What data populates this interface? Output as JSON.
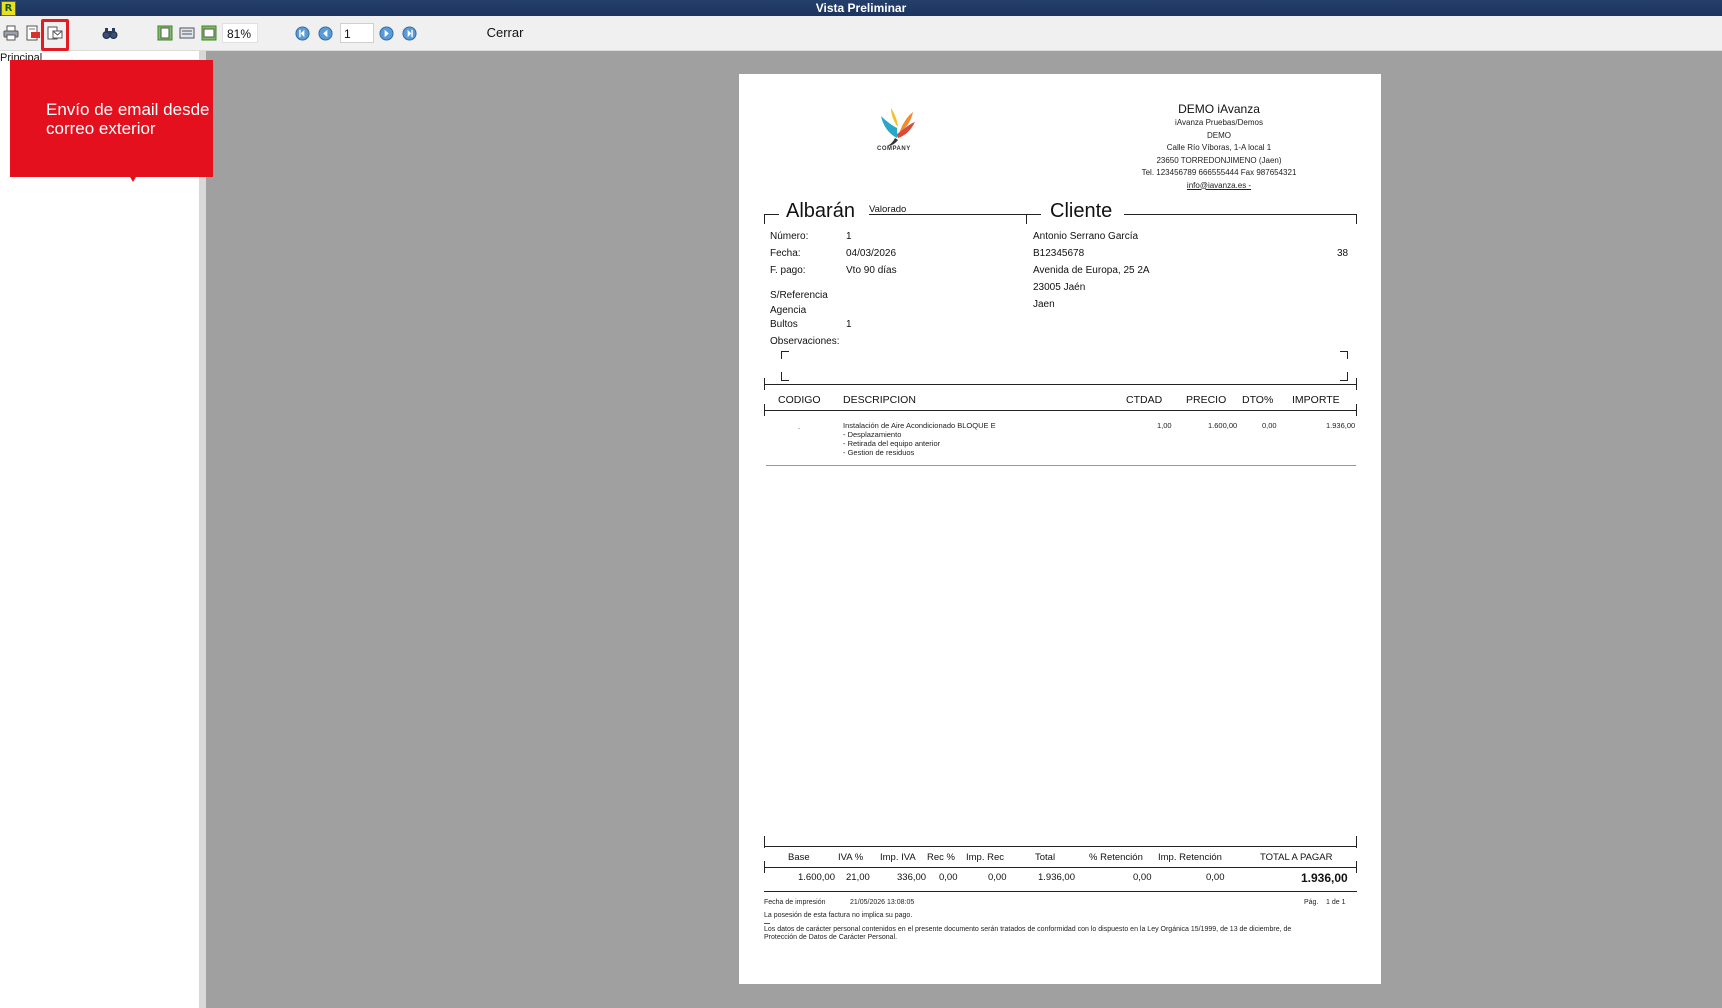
{
  "window": {
    "title": "Vista Preliminar",
    "app_icon_letter": "R"
  },
  "toolbar": {
    "zoom": "81%",
    "page_value": "1",
    "close_label": "Cerrar",
    "icons": [
      "print-icon",
      "export-icon",
      "email-icon",
      "find-icon",
      "single-page-icon",
      "two-page-icon",
      "page-width-icon",
      "first-page-icon",
      "previous-page-icon",
      "next-page-icon",
      "last-page-icon"
    ]
  },
  "sidebar": {
    "tree_root": "Principal"
  },
  "callout": {
    "text": "Envío de email desde un correo exterior",
    "color": "#e5101e"
  },
  "document": {
    "company": {
      "logo_text": "COMPANY",
      "name": "DEMO iAvanza",
      "lines": [
        "iAvanza Pruebas/Demos",
        "DEMO",
        "Calle Río Víboras, 1-A local 1",
        "23650 TORREDONJIMENO (Jaen)",
        "Tel. 123456789  666555444  Fax 987654321"
      ],
      "email": "info@iavanza.es -"
    },
    "albaran": {
      "title": "Albarán",
      "subtitle": "Valorado",
      "fields": [
        {
          "label": "Número:",
          "value": "1"
        },
        {
          "label": "Fecha:",
          "value": "04/03/2026"
        },
        {
          "label": "F. pago:",
          "value": "Vto 90 días"
        }
      ],
      "sref_label": "S/Referencia",
      "agencia_label": "Agencia",
      "bultos_label": "Bultos",
      "bultos_value": "1",
      "observaciones_label": "Observaciones:"
    },
    "cliente": {
      "title": "Cliente",
      "name": "Antonio Serrano García",
      "nif": "B12345678",
      "code": "38",
      "address": "Avenida de Europa, 25 2A",
      "postal": "23005  Jaén",
      "city": "Jaen"
    },
    "lines_table": {
      "headers": {
        "codigo": "CODIGO",
        "descripcion": "DESCRIPCION",
        "ctdad": "CTDAD",
        "precio": "PRECIO",
        "dto": "DTO%",
        "importe": "IMPORTE"
      },
      "rows": [
        {
          "codigo": ".",
          "descripcion": [
            "Instalación de Aire Acondicionado BLOQUE E",
            "- Desplazamiento",
            "- Retirada del equipo anterior",
            "- Gestion de residuos"
          ],
          "ctdad": "1,00",
          "precio": "1.600,00",
          "dto": "0,00",
          "importe": "1.936,00"
        }
      ]
    },
    "totals": {
      "headers": {
        "base": "Base",
        "iva": "IVA %",
        "imp_iva": "Imp. IVA",
        "rec": "Rec %",
        "imp_rec": "Imp. Rec",
        "total": "Total",
        "ret": "% Retención",
        "imp_ret": "Imp. Retención",
        "total_pagar": "TOTAL A PAGAR"
      },
      "values": {
        "base": "1.600,00",
        "iva": "21,00",
        "imp_iva": "336,00",
        "rec": "0,00",
        "imp_rec": "0,00",
        "total": "1.936,00",
        "ret": "0,00",
        "imp_ret": "0,00",
        "total_pagar": "1.936,00"
      }
    },
    "footer": {
      "print_date_label": "Fecha de impresión",
      "print_date": "21/05/2026 13:08:05",
      "page_label": "Pág.",
      "page_value": "1 de 1",
      "note1": "La posesión de esta factura no implica su pago.",
      "note2_line1": "Los datos de carácter personal contenidos en el presente documento serán tratados  de conformidad con lo dispuesto en la Ley Orgánica 15/1999, de 13 de diciembre, de",
      "note2_line2": "Protección de Datos de Carácter Personal."
    }
  }
}
